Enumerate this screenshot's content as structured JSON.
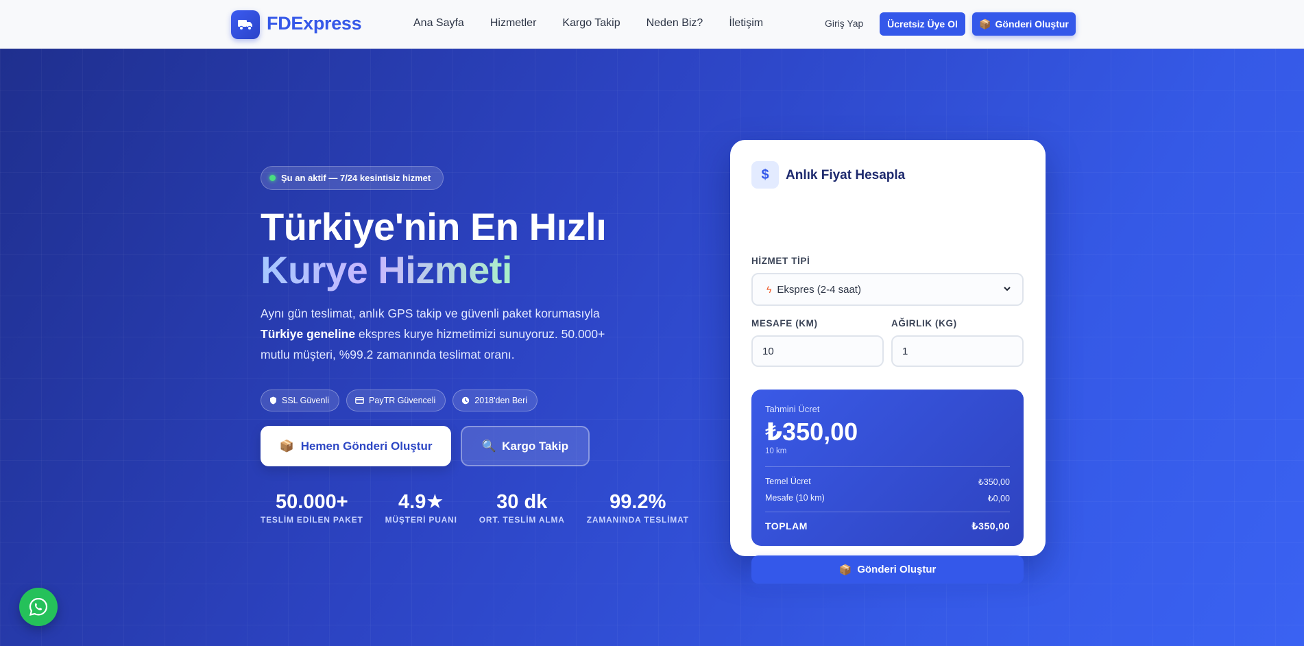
{
  "nav": {
    "brand": "FDExpress",
    "brand_icon": "truck-icon",
    "links": [
      "Ana Sayfa",
      "Hizmetler",
      "Kargo Takip",
      "Neden Biz?",
      "İletişim"
    ],
    "login": "Giriş Yap",
    "signup": "Ücretsiz Üye Ol",
    "create": "Gönderi Oluştur"
  },
  "hero": {
    "status": "Şu an aktif — 7/24 kesintisiz hizmet",
    "title_line1": "Türkiye'nin En Hızlı",
    "title_line2": "Kurye Hizmeti",
    "desc_part1": "Aynı gün teslimat, anlık GPS takip ve güvenli paket korumasıyla ",
    "desc_bold": "Türkiye geneline",
    "desc_part2": " ekspres kurye hizmetimizi sunuyoruz. 50.000+ mutlu müşteri, %99.2 zamanında teslimat oranı.",
    "badges": [
      {
        "icon": "shield-icon",
        "label": "SSL Güvenli"
      },
      {
        "icon": "credit-card-icon",
        "label": "PayTR Güvenceli"
      },
      {
        "icon": "clock-icon",
        "label": "2018'den Beri"
      }
    ],
    "primary_btn": "Hemen Gönderi Oluştur",
    "secondary_btn": "Kargo Takip",
    "stats": [
      {
        "value": "50.000+",
        "label": "TESLİM EDİLEN PAKET"
      },
      {
        "value": "4.9★",
        "label": "MÜŞTERİ PUANI"
      },
      {
        "value": "30 dk",
        "label": "ORT. TESLİM ALMA"
      },
      {
        "value": "99.2%",
        "label": "ZAMANINDA TESLİMAT"
      }
    ]
  },
  "calculator": {
    "icon": "$",
    "title": "Anlık Fiyat Hesapla",
    "service_label": "HİZMET TİPİ",
    "service_value": "Ekspres (2-4 saat)",
    "distance_label": "MESAFE (KM)",
    "distance_value": "10",
    "weight_label": "AĞIRLIK (KG)",
    "weight_value": "1",
    "estimate_label": "Tahmini Ücret",
    "estimate_price": "₺350,00",
    "estimate_sub": "10 km",
    "rows": [
      {
        "label": "Temel Ücret",
        "value": "₺350,00"
      },
      {
        "label": "Mesafe (10 km)",
        "value": "₺0,00"
      }
    ],
    "total_label": "TOPLAM",
    "total_value": "₺350,00",
    "submit": "Gönderi Oluştur"
  },
  "colors": {
    "accent": "#3458ea",
    "hero_dark": "#1f2f8e",
    "hero_light": "#3a62f2",
    "whatsapp": "#25c15a",
    "status_dot": "#4ade80"
  }
}
